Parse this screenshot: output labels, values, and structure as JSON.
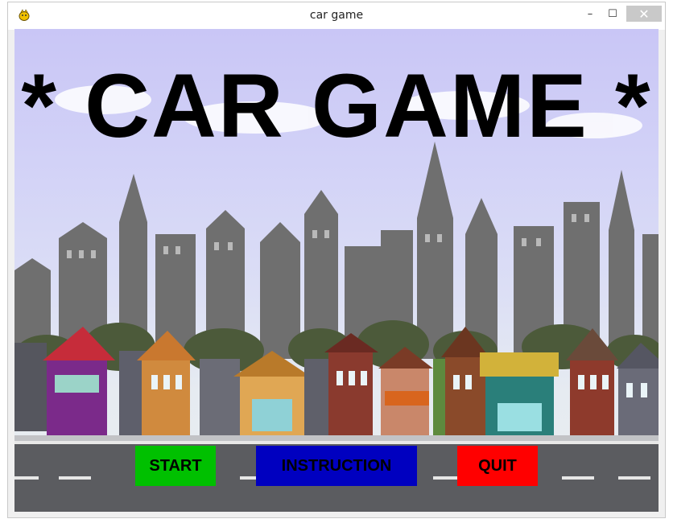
{
  "window": {
    "title": "car game",
    "icon": "pygame-snake-icon",
    "controls": {
      "minimize": "–",
      "maximize": "☐",
      "close": "✕"
    }
  },
  "game": {
    "title": "* CAR GAME *",
    "buttons": [
      {
        "label": "START",
        "color": "#00c000"
      },
      {
        "label": "INSTRUCTION",
        "color": "#0000c0"
      },
      {
        "label": "QUIT",
        "color": "#ff0000"
      }
    ],
    "background": "city-street-illustration"
  }
}
